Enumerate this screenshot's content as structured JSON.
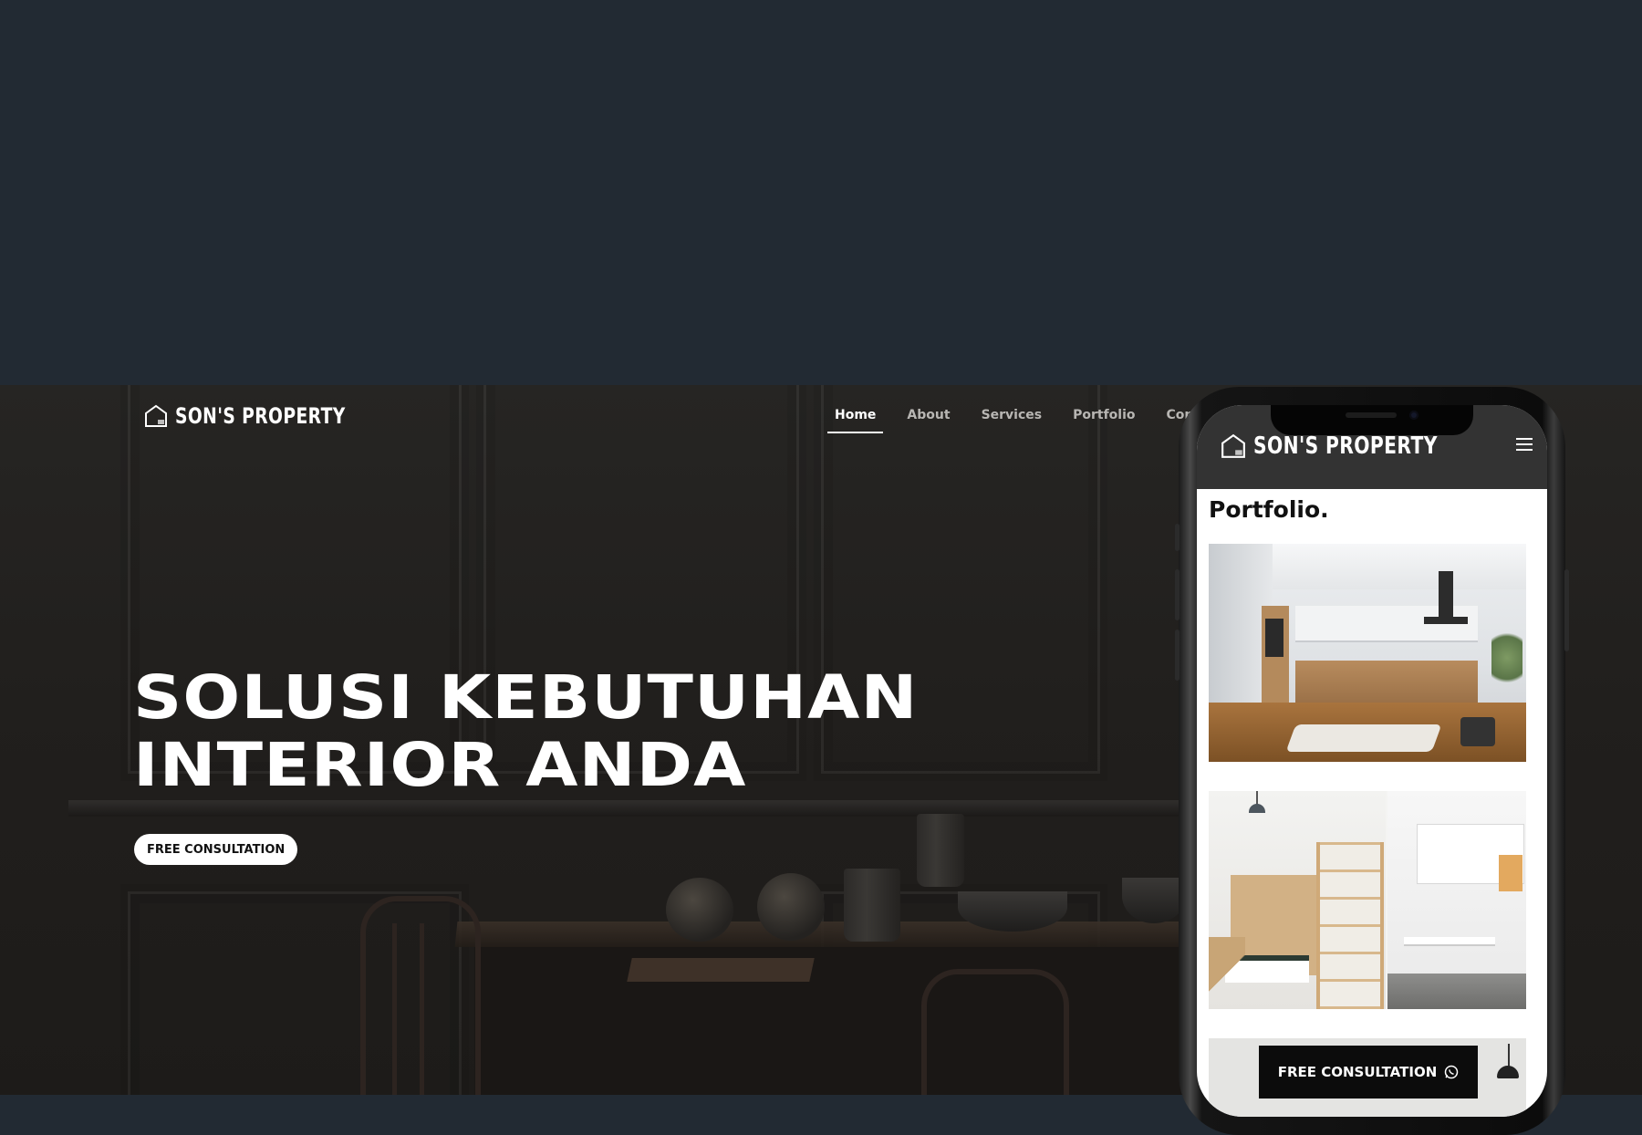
{
  "colors": {
    "page_background": "#222a33",
    "hero_background": "#211f1d",
    "mobile_header": "#333333",
    "accent": "#ffffff",
    "cta_mobile_bg": "#0c0c0c"
  },
  "desktop": {
    "brand": {
      "name": "SON'S PROPERTY",
      "logo_icon": "house-logo-icon"
    },
    "nav": {
      "items": [
        {
          "label": "Home",
          "active": true
        },
        {
          "label": "About",
          "active": false
        },
        {
          "label": "Services",
          "active": false
        },
        {
          "label": "Portfolio",
          "active": false
        },
        {
          "label": "Contact",
          "active": false
        }
      ]
    },
    "hero": {
      "headline_line1": "SOLUSI KEBUTUHAN",
      "headline_line2": "INTERIOR ANDA",
      "cta_label": "FREE CONSULTATION"
    }
  },
  "mobile": {
    "brand": {
      "name": "SON'S PROPERTY",
      "logo_icon": "house-logo-icon"
    },
    "menu_icon": "hamburger-menu-icon",
    "section_title": "Portfolio.",
    "portfolio_images": [
      "kitchen-photo",
      "bedroom-photo",
      "room-photo"
    ],
    "cta_label": "FREE CONSULTATION",
    "cta_icon": "whatsapp-icon"
  }
}
